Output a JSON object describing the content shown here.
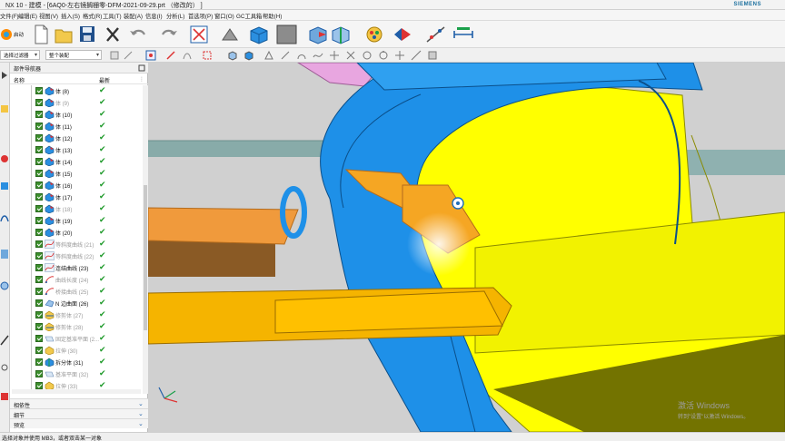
{
  "title_bar": {
    "title": "NX 10 - 建模 - [6AQ0-左右镜搁栅零-DFM-2021-09-29.prt （修改的） ]",
    "brand": "SIEMENS"
  },
  "menu": {
    "items": [
      "文件(F)",
      "编辑(E)",
      "视图(V)",
      "插入(S)",
      "格式(R)",
      "工具(T)",
      "装配(A)",
      "信息(I)",
      "分析(L)",
      "首选项(P)",
      "窗口(O)",
      "GC工具箱",
      "帮助(H)"
    ]
  },
  "toolbar": {
    "start_label": "启动"
  },
  "filter_bar": {
    "filter_label": "选择过滤器",
    "scope_label": "整个装配"
  },
  "navigator": {
    "title": "部件导航器",
    "col_name": "名称",
    "col_latest": "最新",
    "rows": [
      {
        "label": "体 (8)",
        "dim": false,
        "icon": "body"
      },
      {
        "label": "体 (9)",
        "dim": true,
        "icon": "body"
      },
      {
        "label": "体 (10)",
        "dim": false,
        "icon": "body"
      },
      {
        "label": "体 (11)",
        "dim": false,
        "icon": "body"
      },
      {
        "label": "体 (12)",
        "dim": false,
        "icon": "body"
      },
      {
        "label": "体 (13)",
        "dim": false,
        "icon": "body"
      },
      {
        "label": "体 (14)",
        "dim": false,
        "icon": "body"
      },
      {
        "label": "体 (15)",
        "dim": false,
        "icon": "body"
      },
      {
        "label": "体 (16)",
        "dim": false,
        "icon": "body"
      },
      {
        "label": "体 (17)",
        "dim": false,
        "icon": "body"
      },
      {
        "label": "体 (18)",
        "dim": true,
        "icon": "body"
      },
      {
        "label": "体 (19)",
        "dim": false,
        "icon": "body"
      },
      {
        "label": "体 (20)",
        "dim": false,
        "icon": "body"
      },
      {
        "label": "等斜度曲线 (21)",
        "dim": true,
        "icon": "curve"
      },
      {
        "label": "等斜度曲线 (22)",
        "dim": true,
        "icon": "curve"
      },
      {
        "label": "连结曲线 (23)",
        "dim": false,
        "icon": "curve"
      },
      {
        "label": "曲线长度 (24)",
        "dim": true,
        "icon": "curve2"
      },
      {
        "label": "桥接曲线 (25)",
        "dim": true,
        "icon": "curve2"
      },
      {
        "label": "N 边曲面 (26)",
        "dim": false,
        "icon": "surface"
      },
      {
        "label": "修剪体 (27)",
        "dim": true,
        "icon": "trim"
      },
      {
        "label": "修剪体 (28)",
        "dim": true,
        "icon": "trim"
      },
      {
        "label": "固定基准平面 (2...",
        "dim": true,
        "icon": "plane"
      },
      {
        "label": "拉伸 (30)",
        "dim": true,
        "icon": "extrude"
      },
      {
        "label": "拆分体 (31)",
        "dim": false,
        "icon": "split"
      },
      {
        "label": "基准平面 (32)",
        "dim": true,
        "icon": "plane"
      },
      {
        "label": "拉伸 (33)",
        "dim": true,
        "icon": "extrude"
      }
    ],
    "panels": [
      "相依性",
      "细节",
      "预览"
    ]
  },
  "watermark": {
    "line1": "激活 Windows",
    "line2": "转到\"设置\"以激活 Windows。"
  },
  "status": {
    "text": "选择对象并使用 MB3，或者双击某一对象"
  },
  "colors": {
    "blue_body": "#1e90e8",
    "yellow_body": "#ffff00",
    "orange_body": "#f5a623",
    "check_green": "#1f9a2a"
  }
}
